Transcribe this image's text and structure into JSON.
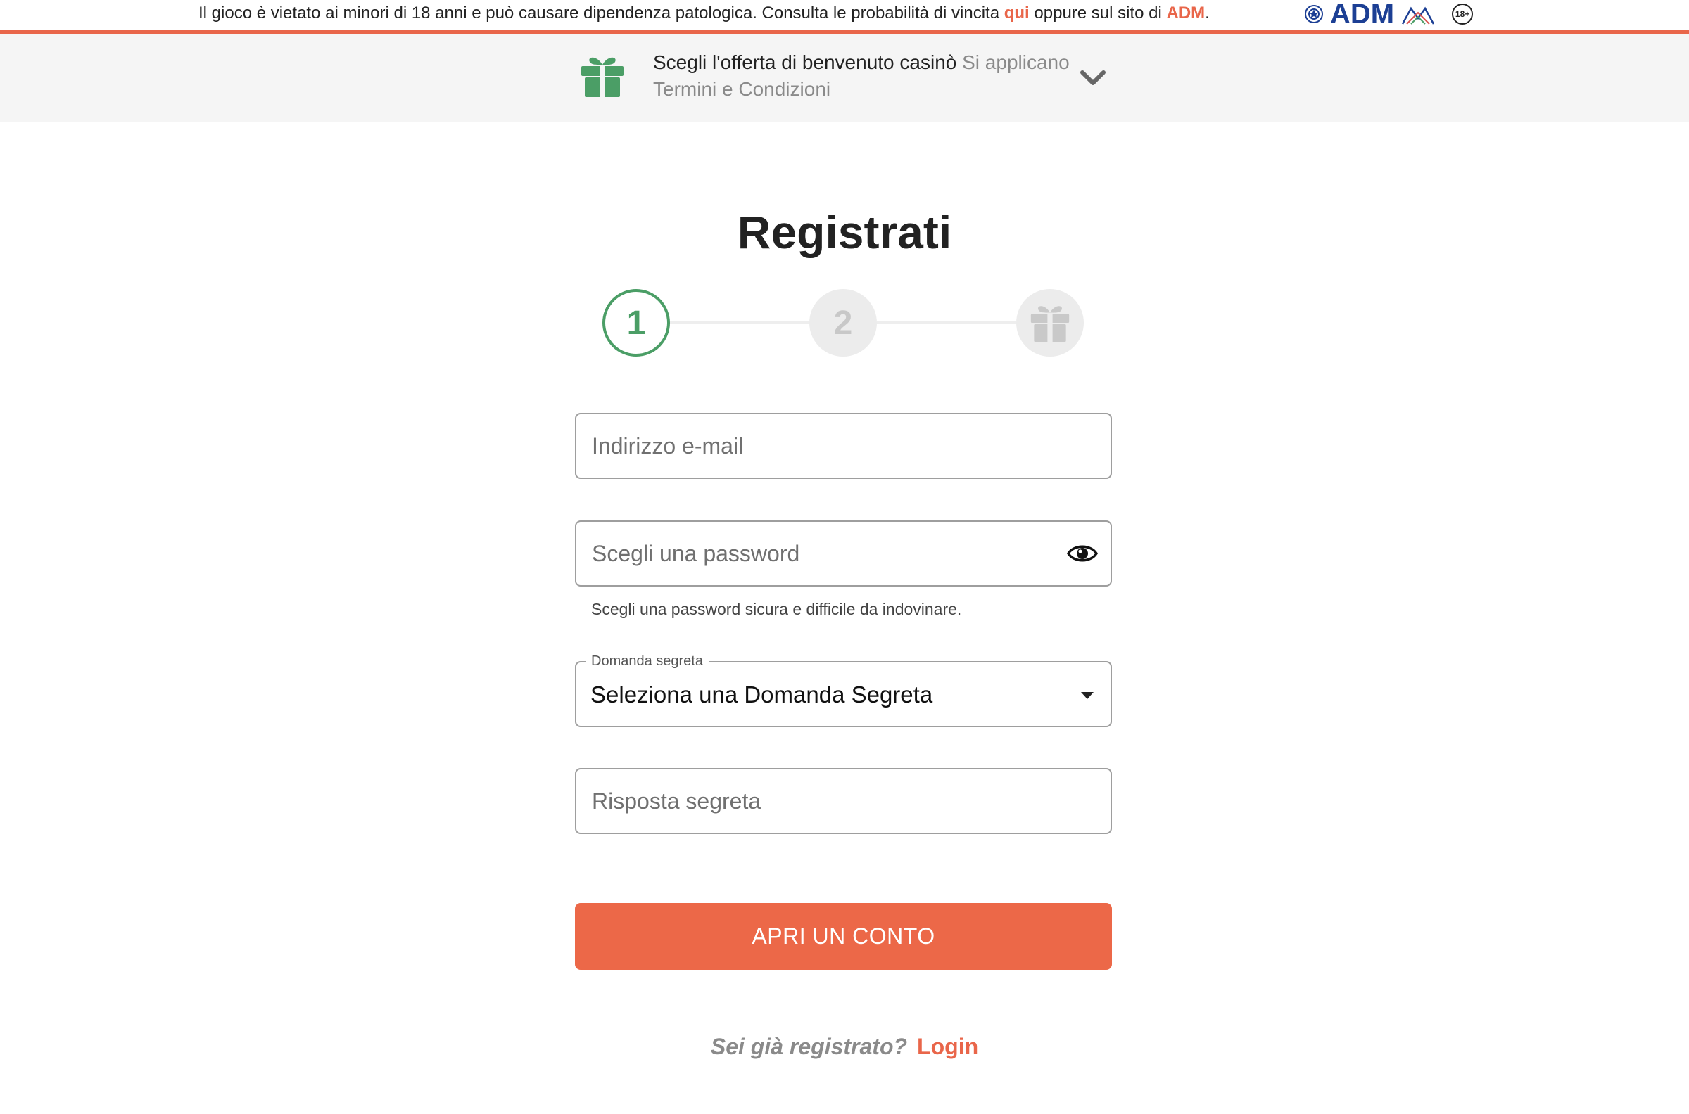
{
  "disclaimer": {
    "text_before": "Il gioco è vietato ai minori di 18 anni e può causare dipendenza patologica. Consulta le probabilità di vincita ",
    "link_qui": "qui",
    "text_middle": " oppure sul sito di ",
    "link_adm": "ADM",
    "text_after": ".",
    "adm_logo": "ADM",
    "age_badge": "18+"
  },
  "offer": {
    "icon": "gift-icon",
    "title": "Scegli l'offerta di benvenuto casinò",
    "terms": " Si applicano Termini e Condizioni",
    "chevron": "chevron-down-icon"
  },
  "page": {
    "title": "Registrati"
  },
  "stepper": {
    "steps": [
      "1",
      "2",
      "gift"
    ],
    "active_step": 1
  },
  "form": {
    "email_placeholder": "Indirizzo e-mail",
    "password_placeholder": "Scegli una password",
    "password_hint": "Scegli una password sicura e difficile da indovinare.",
    "secret_question_label": "Domanda segreta",
    "secret_question_value": "Seleziona una Domanda Segreta",
    "secret_answer_placeholder": "Risposta segreta",
    "submit_label": "APRI UN CONTO"
  },
  "login": {
    "question": "Sei già registrato?",
    "link_label": "Login"
  },
  "colors": {
    "accent": "#ec6848",
    "step_active": "#4b9e66",
    "gift_green": "#4b9e66",
    "adm_blue": "#1c3f94"
  }
}
